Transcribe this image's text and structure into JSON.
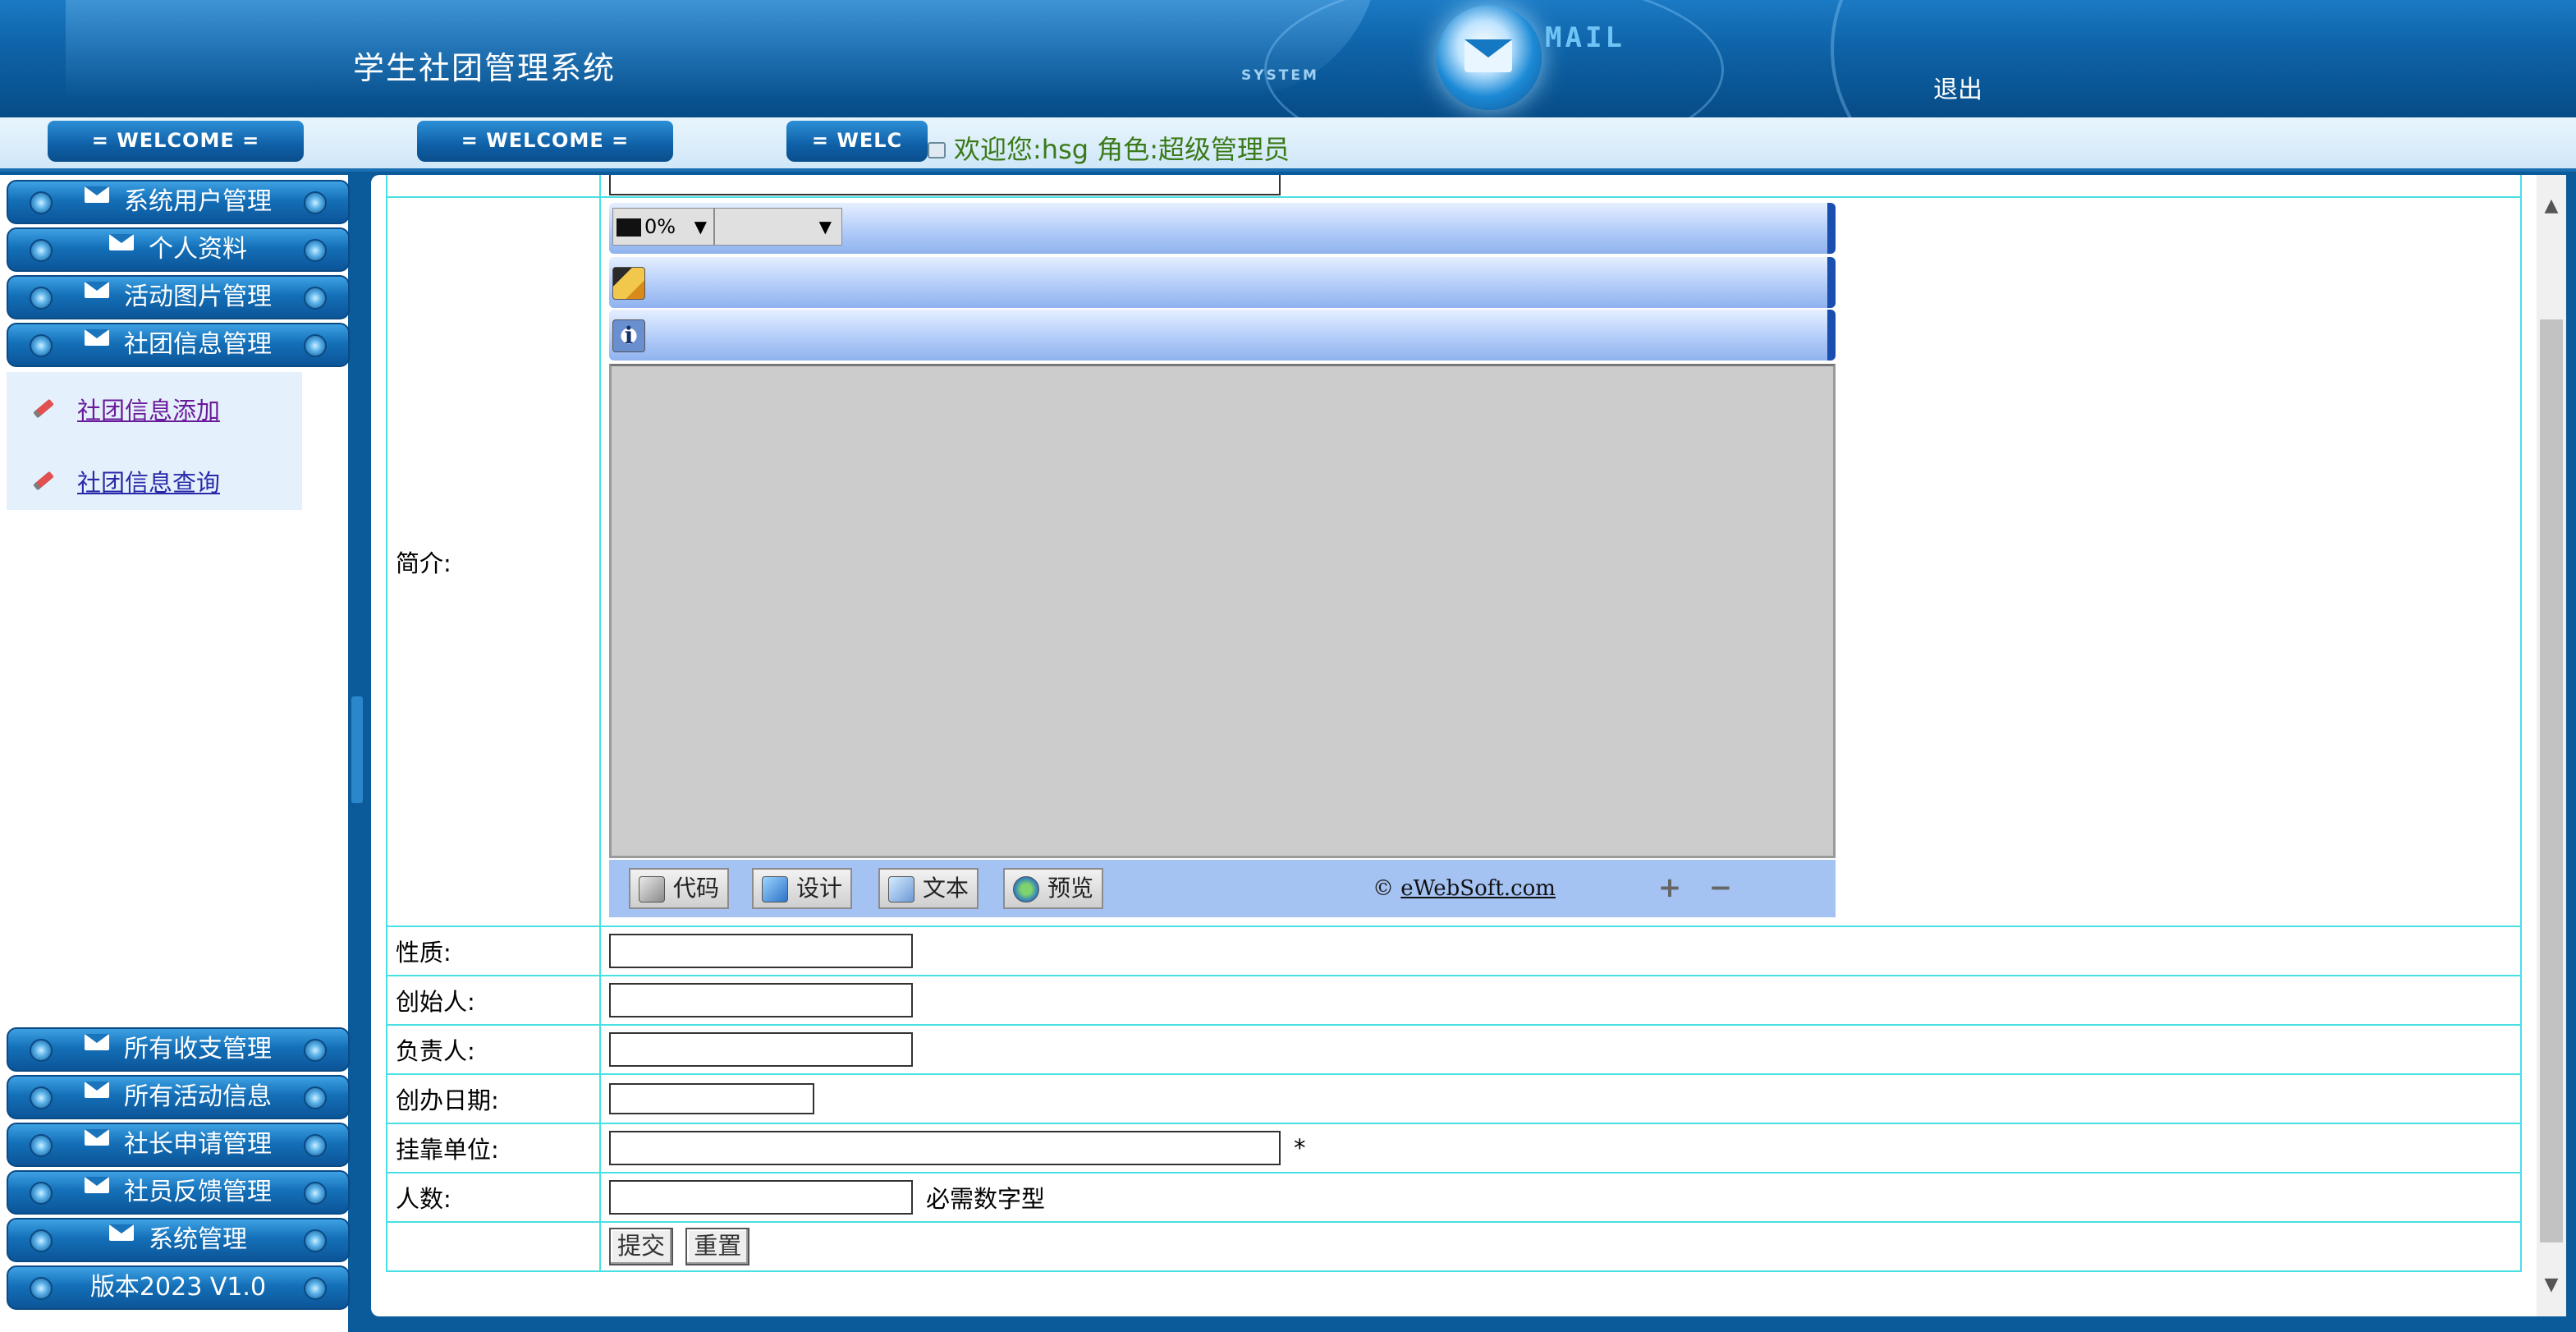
{
  "header": {
    "app_title": "学生社团管理系统",
    "system_tag": "SYSTEM",
    "mail_tag": "MAIL",
    "logout_label": "退出"
  },
  "topbar": {
    "tabs": [
      "= WELCOME =",
      "= WELCOME =",
      "= WELC"
    ],
    "welcome_message": "欢迎您:hsg 角色:超级管理员"
  },
  "sidebar": {
    "menu_top": [
      "系统用户管理",
      "个人资料",
      "活动图片管理",
      "社团信息管理"
    ],
    "submenu": [
      "社团信息添加",
      "社团信息查询"
    ],
    "menu_bottom": [
      "所有收支管理",
      "所有活动信息",
      "社长申请管理",
      "社员反馈管理",
      "系统管理"
    ],
    "version": "版本2023 V1.0"
  },
  "form": {
    "fields": {
      "intro_label": "简介:",
      "nature_label": "性质:",
      "founder_label": "创始人:",
      "leader_label": "负责人:",
      "founded_date_label": "创办日期:",
      "affiliated_unit_label": "挂靠单位:",
      "affiliated_required": "*",
      "member_count_label": "人数:",
      "member_count_hint": "必需数字型"
    },
    "values": {
      "nature": "",
      "founder": "",
      "leader": "",
      "founded_date": "",
      "affiliated_unit": "",
      "member_count": ""
    },
    "submit_label": "提交",
    "reset_label": "重置"
  },
  "editor": {
    "zoom_value": "0%",
    "mode_buttons": [
      "代码",
      "设计",
      "文本",
      "预览"
    ],
    "copyright_symbol": "©",
    "copyright_link": "eWebSoft.com",
    "icons": [
      "image-icon",
      "info-icon",
      "zoom-in-icon",
      "zoom-out-icon"
    ]
  },
  "colors": {
    "header_blue": "#0e63a8",
    "table_border": "#49e0e4",
    "welcome_green": "#3b7a18",
    "editor_area": "#cccccc"
  }
}
